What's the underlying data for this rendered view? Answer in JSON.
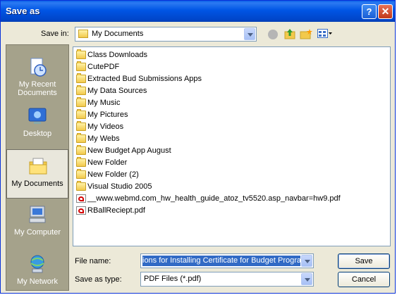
{
  "window": {
    "title": "Save as",
    "help": "?",
    "close": "✕"
  },
  "save_in": {
    "label": "Save in:",
    "value": "My Documents"
  },
  "toolbar": {
    "back": "back-icon",
    "up": "up-folder-icon",
    "new_folder": "new-folder-icon",
    "views": "views-menu-icon"
  },
  "places": [
    {
      "label": "My Recent Documents"
    },
    {
      "label": "Desktop"
    },
    {
      "label": "My Documents"
    },
    {
      "label": "My Computer"
    },
    {
      "label": "My Network"
    }
  ],
  "files": [
    {
      "name": "Class Downloads",
      "type": "folder"
    },
    {
      "name": "CutePDF",
      "type": "folder"
    },
    {
      "name": "Extracted Bud Submissions Apps",
      "type": "folder"
    },
    {
      "name": "My Data Sources",
      "type": "folder"
    },
    {
      "name": "My Music",
      "type": "folder"
    },
    {
      "name": "My Pictures",
      "type": "folder"
    },
    {
      "name": "My Videos",
      "type": "folder"
    },
    {
      "name": "My Webs",
      "type": "folder"
    },
    {
      "name": "New Budget App August",
      "type": "folder"
    },
    {
      "name": "New Folder",
      "type": "folder"
    },
    {
      "name": "New Folder (2)",
      "type": "folder"
    },
    {
      "name": "Visual Studio 2005",
      "type": "folder"
    },
    {
      "name": "__www.webmd.com_hw_health_guide_atoz_tv5520.asp_navbar=hw9.pdf",
      "type": "pdf"
    },
    {
      "name": "RBallReciept.pdf",
      "type": "pdf"
    }
  ],
  "file_name": {
    "label": "File name:",
    "value": "ions for Installing Certificate for Budget Program"
  },
  "save_as_type": {
    "label": "Save as type:",
    "value": "PDF Files (*.pdf)"
  },
  "buttons": {
    "save": "Save",
    "cancel": "Cancel"
  }
}
